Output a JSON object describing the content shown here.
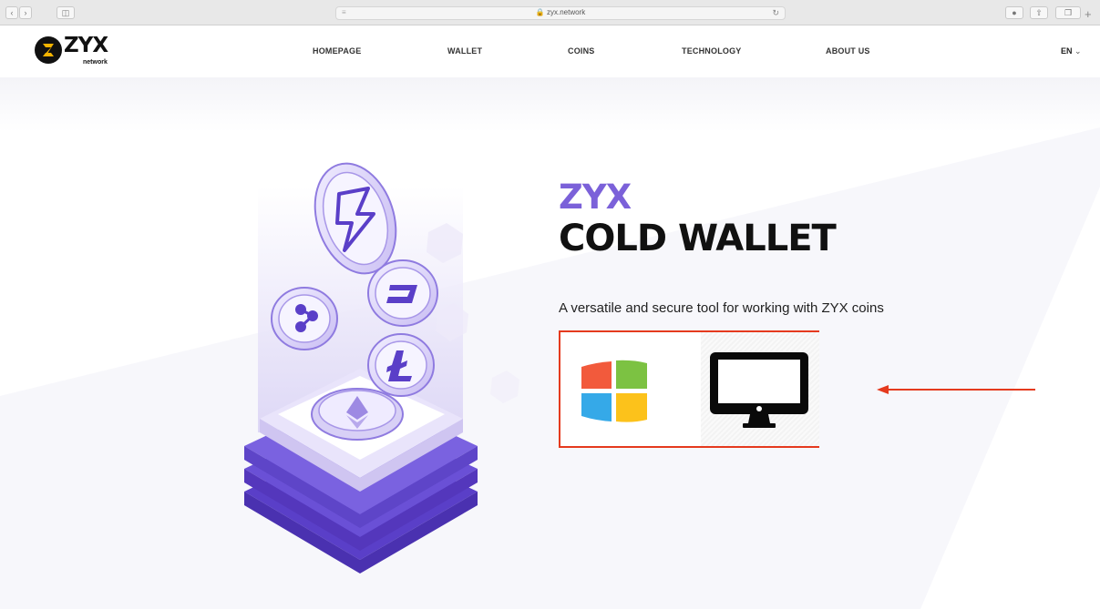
{
  "browser": {
    "url": "zyx.network",
    "colors": {
      "chrome": "#e8e8e8"
    }
  },
  "header": {
    "logo": {
      "name": "ZYX",
      "sub": "network"
    },
    "nav": [
      "HOMEPAGE",
      "WALLET",
      "COINS",
      "TECHNOLOGY",
      "ABOUT US"
    ],
    "language": "EN"
  },
  "hero": {
    "title_accent": "ZYX",
    "title": "COLD WALLET",
    "subtitle": "A versatile and secure tool for working with ZYX coins",
    "downloads": [
      {
        "icon": "windows-icon",
        "label": ""
      },
      {
        "icon": "monitor-icon",
        "label": ""
      }
    ],
    "colors": {
      "accent": "#7b61d9",
      "highlight": "#e53a1e"
    }
  }
}
